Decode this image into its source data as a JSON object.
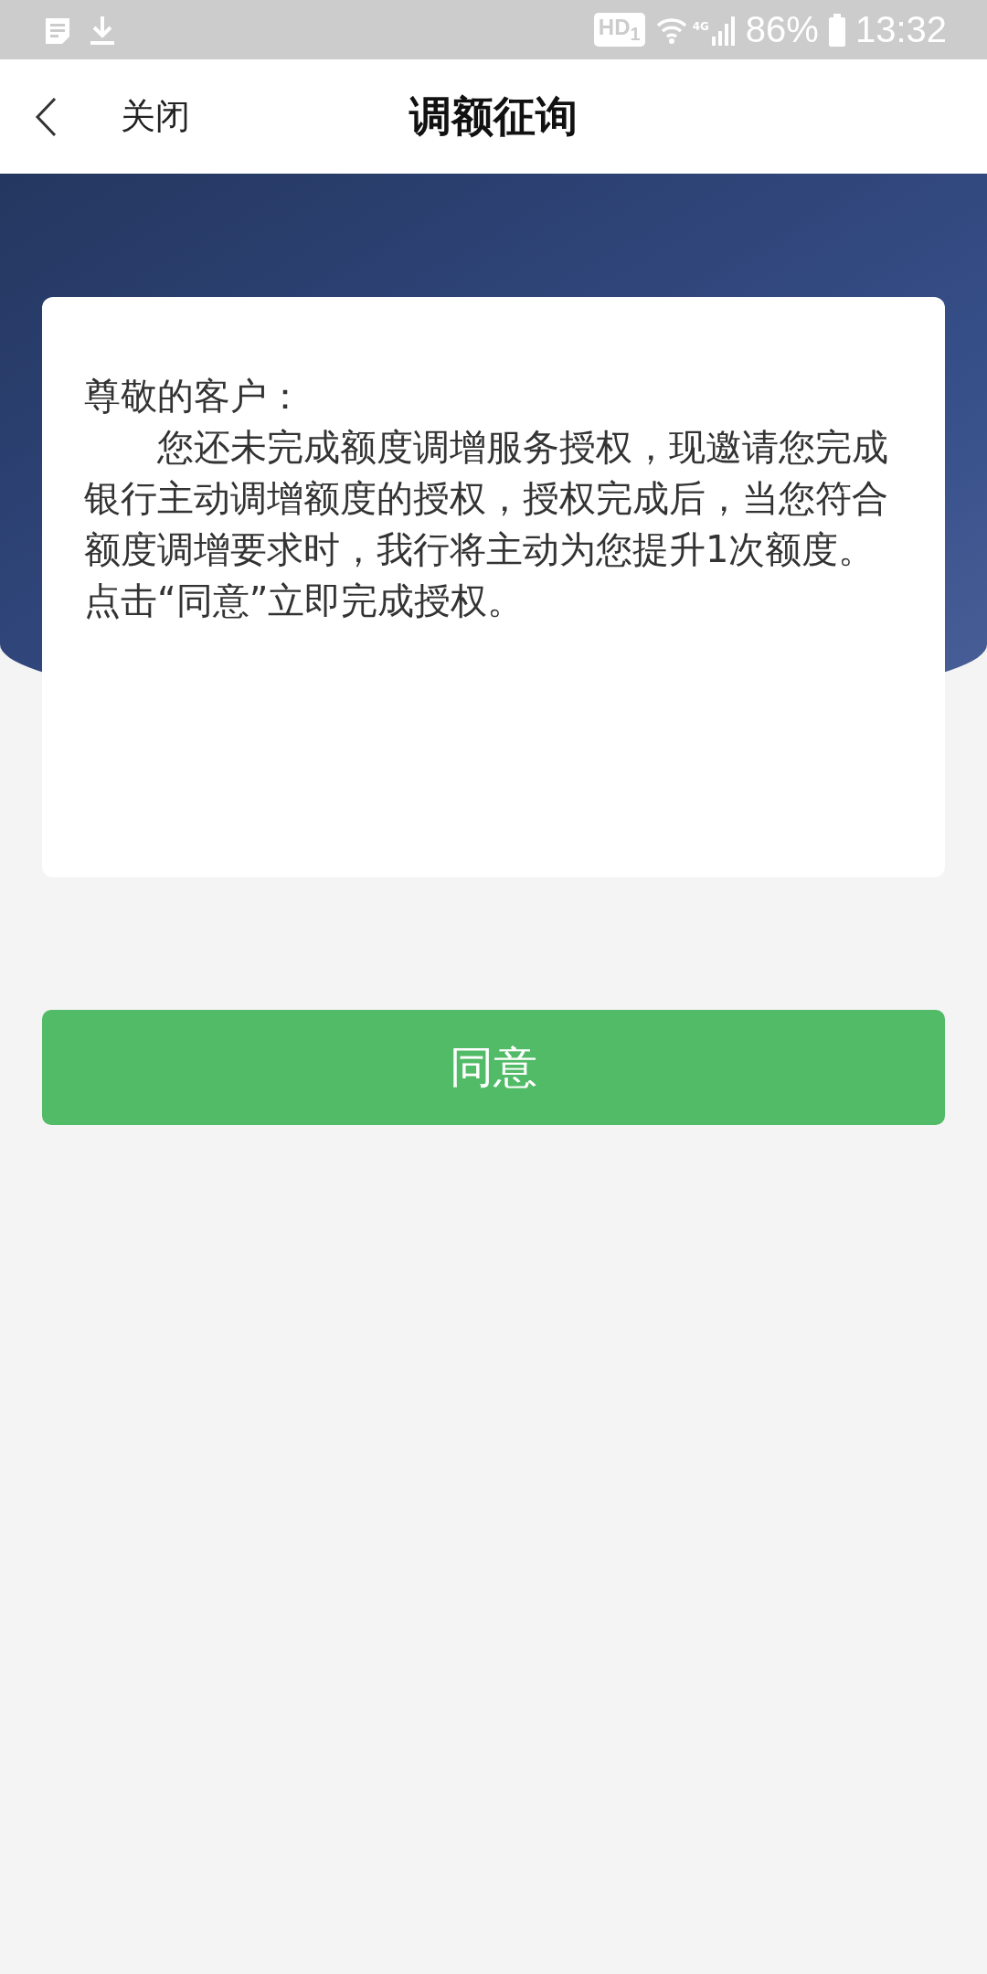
{
  "status_bar": {
    "network": "4G",
    "hd_badge": "HD$_{1}$",
    "battery": "86%",
    "time": "13:32"
  },
  "header": {
    "close": "关闭",
    "title": "调额征询"
  },
  "letter": {
    "greeting": "尊敬的客户：",
    "body": "您还未完成额度调增服务授权，现邀请您完成银行主动调增额度的授权，授权完成后，当您符合额度调增要求时，我行将主动为您提升1次额度。点击“同意”立即完成授权。"
  },
  "button": "同意"
}
